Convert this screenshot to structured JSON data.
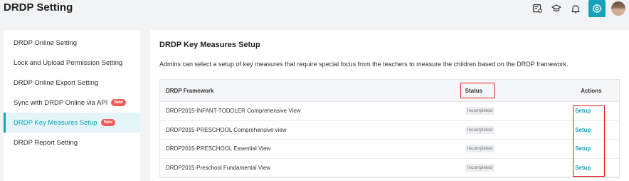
{
  "header": {
    "title": "DRDP Setting"
  },
  "top_icons": [
    "id-card-icon",
    "graduation-cap-icon",
    "bell-icon",
    "gear-icon",
    "user-avatar"
  ],
  "colors": {
    "accent": "#17a2b8",
    "badge": "#ef5b5b",
    "highlight": "#e0201b"
  },
  "sidebar": {
    "items": [
      {
        "label": "DRDP Online Setting",
        "badge": ""
      },
      {
        "label": "Lock and Upload Permission Setting",
        "badge": ""
      },
      {
        "label": "DRDP Online Export Setting",
        "badge": ""
      },
      {
        "label": "Sync with DRDP Online via API",
        "badge": "New"
      },
      {
        "label": "DRDP Key Measures Setup",
        "badge": "New",
        "active": true
      },
      {
        "label": "DRDP Report Setting",
        "badge": ""
      }
    ]
  },
  "main": {
    "title": "DRDP Key Measures Setup",
    "description": "Admins can select a setup of key measures that require special focus from the teachers to measure the children based on the DRDP framework.",
    "table": {
      "headers": {
        "framework": "DRDP Framework",
        "status": "Status",
        "actions": "Actions"
      },
      "rows": [
        {
          "framework": "DRDP2015-INFANT-TODDLER Comprehensive View",
          "status": "Incompleted",
          "action": "Setup"
        },
        {
          "framework": "DRDP2015-PRESCHOOL Comprehensive view",
          "status": "Incompleted",
          "action": "Setup"
        },
        {
          "framework": "DRDP2015-PRESCHOOL Essential View",
          "status": "Incompleted",
          "action": "Setup"
        },
        {
          "framework": "DRDP2015-Preschool Fundamental View",
          "status": "Incompleted",
          "action": "Setup"
        }
      ]
    }
  }
}
